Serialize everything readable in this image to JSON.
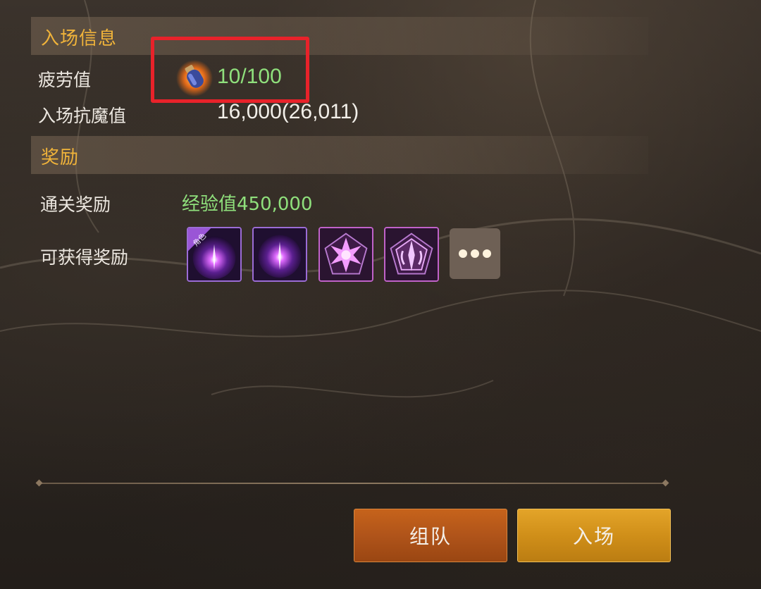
{
  "sections": {
    "entry_info": {
      "title": "入场信息"
    },
    "reward": {
      "title": "奖励"
    }
  },
  "entry": {
    "fatigue_label": "疲劳值",
    "fatigue_value": "10/100",
    "fatigue_icon": "fatigue-potion-icon",
    "resist_label": "入场抗魔值",
    "resist_value": "16,000(26,011)"
  },
  "rewards": {
    "clear_label": "通关奖励",
    "clear_value": "经验值450,000",
    "obtainable_label": "可获得奖励",
    "items": [
      {
        "icon": "character-purple-orb-icon",
        "badge": "角色",
        "rarity_color": "#9b6cd6"
      },
      {
        "icon": "purple-orb-icon",
        "rarity_color": "#9b6cd6"
      },
      {
        "icon": "purple-star-emblem-icon",
        "rarity_color": "#c062c9"
      },
      {
        "icon": "purple-shield-emblem-icon",
        "rarity_color": "#c062c9"
      }
    ],
    "more_icon": "more-dots-icon"
  },
  "buttons": {
    "team_label": "组队",
    "enter_label": "入场"
  },
  "colors": {
    "header_text": "#f0b33a",
    "positive_value": "#8fe07c",
    "highlight": "#e8222a"
  }
}
